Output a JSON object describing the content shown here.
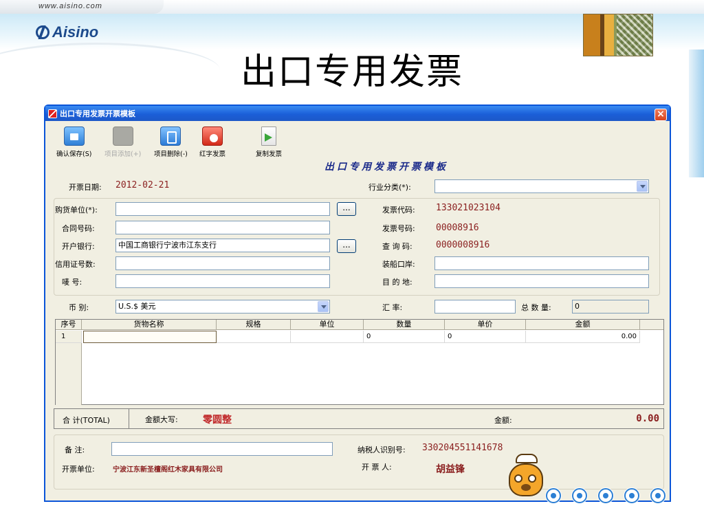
{
  "slide": {
    "url": "www.aisino.com",
    "logo": "Aisino",
    "title": "出口专用发票"
  },
  "window": {
    "title": "出口专用发票开票模板",
    "close_glyph": "×"
  },
  "toolbar": {
    "save": "确认保存(S)",
    "add": "项目添加(+)",
    "delete": "项目删除(-)",
    "red_invoice": "红字发票",
    "copy_invoice": "复制发票"
  },
  "form": {
    "title": "出口专用发票开票模板",
    "date_label": "开票日期:",
    "date_value": "2012-02-21",
    "industry_label": "行业分类(*):",
    "industry_value": "",
    "buyer_label": "购货单位(*):",
    "buyer_value": "",
    "contract_label": "合同号码:",
    "contract_value": "",
    "bank_label": "开户银行:",
    "bank_value": "中国工商银行宁波市江东支行",
    "lc_label": "信用证号数:",
    "lc_value": "",
    "mark_label": "唛    号:",
    "mark_value": "",
    "invoice_code_label": "发票代码:",
    "invoice_code_value": "133021023104",
    "invoice_no_label": "发票号码:",
    "invoice_no_value": "00008916",
    "query_label": "查 询 码:",
    "query_value": "0000008916",
    "port_label": "装船口岸:",
    "port_value": "",
    "dest_label": "目 的 地:",
    "dest_value": "",
    "currency_label": "币    别:",
    "currency_value": "U.S.$ 美元",
    "rate_label": "汇    率:",
    "rate_value": "",
    "qty_label": "总 数 量:",
    "qty_value": "0",
    "dots": "..."
  },
  "grid": {
    "headers": [
      "序号",
      "货物名称",
      "规格",
      "单位",
      "数量",
      "单价",
      "金额"
    ],
    "rows": [
      {
        "no": "1",
        "name": "",
        "spec": "",
        "unit": "",
        "qty": "0",
        "price": "0",
        "amount": "0.00"
      }
    ]
  },
  "totals": {
    "label": "合  计(TOTAL)",
    "words_label": "金额大写:",
    "words_value": "零圆整",
    "amount_label": "金额:",
    "amount_value": "0.00"
  },
  "footer": {
    "remark_label": "备    注:",
    "remark_value": "",
    "taxid_label": "纳税人识别号:",
    "taxid_value": "330204551141678",
    "issuer_label": "开票单位:",
    "issuer_value": "宁波江东新圣檀阁红木家具有限公司",
    "drawer_label": "开    票    人:",
    "drawer_value": "胡益锋"
  },
  "status_icons": [
    "chinese-input-icon",
    "moon-icon",
    "dots-icon",
    "keyboard-icon",
    "wrench-icon"
  ],
  "colors": {
    "title_bar": "#1b5fd8",
    "value_red": "#8a1e1e",
    "form_title": "#1a2a8a",
    "window_bg": "#f1efe2"
  }
}
